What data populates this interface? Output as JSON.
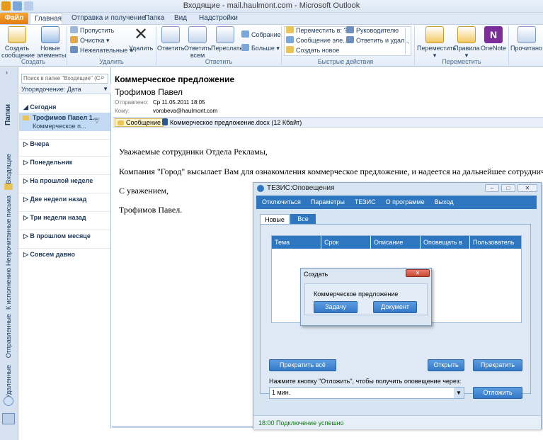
{
  "window": {
    "title": "Входящие - mail.haulmont.com - Microsoft Outlook"
  },
  "ribbon": {
    "tabs": [
      "Файл",
      "Главная",
      "Отправка и получение",
      "Папка",
      "Вид",
      "Надстройки"
    ],
    "create": {
      "new_message": "Создать сообщение",
      "new_items": "Новые элементы",
      "label": "Создать"
    },
    "delete": {
      "ignore": "Пропустить",
      "cleanup": "Очистка",
      "junk": "Нежелательные",
      "delete": "Удалить",
      "label": "Удалить"
    },
    "respond": {
      "reply": "Ответить",
      "reply_all": "Ответить всем",
      "forward": "Переслать",
      "meeting": "Собрание",
      "more": "Больше",
      "label": "Ответить"
    },
    "quick": {
      "move_to": "Переместить в: ?",
      "manager": "Руководителю",
      "team_email": "Сообщение эле...",
      "reply_delete": "Ответить и удал...",
      "create_new": "Создать новое",
      "label": "Быстрые действия"
    },
    "move": {
      "move": "Переместить",
      "rules": "Правила",
      "onenote": "OneNote",
      "label": "Переместить"
    },
    "unread": {
      "read_unread": "Прочитано"
    }
  },
  "nav": {
    "folders": "Папки",
    "inbox": "Входящие",
    "unread": "Непрочитанные письма",
    "todo": "К исполнению",
    "sent": "Отправленные",
    "deleted": "Удаленные"
  },
  "maillist": {
    "search_placeholder": "Поиск в папке \"Входящие\" (C",
    "sort": "Упорядочение: Дата",
    "groups": [
      "Сегодня",
      "Вчера",
      "Понедельник",
      "На прошлой неделе",
      "Две недели назад",
      "Три недели назад",
      "В прошлом месяце",
      "Совсем давно"
    ],
    "selected": {
      "from": "Трофимов Павел 1...",
      "subject": "Коммерческое п..."
    }
  },
  "message": {
    "subject": "Коммерческое предложение",
    "sender": "Трофимов Павел",
    "sent_label": "Отправлено:",
    "sent_value": "Ср 11.05.2011 18:05",
    "to_label": "Кому:",
    "to_value": "vorobeva@haulmont.com",
    "tab_message": "Сообщение",
    "attachment": "Коммерческое предложение.docx (12 Кбайт)",
    "body": [
      "Уважаемые сотрудники Отдела Рекламы,",
      "Компания \"Город\" высылает Вам для ознакомления коммерческое предложение, и надеется на дальнейшее сотрудничество.",
      "С уважением,",
      "Трофимов Павел."
    ]
  },
  "tesis": {
    "title": "ТЕЗИС:Оповещения",
    "menu": [
      "Отключиться",
      "Параметры",
      "ТЕЗИС",
      "О программе",
      "Выход"
    ],
    "tabs": [
      "Новые",
      "Все"
    ],
    "columns": [
      "Тема",
      "Срок",
      "Описание",
      "Оповещать в",
      "Пользователь"
    ],
    "stop_all": "Прекратить всё",
    "open": "Открыть",
    "stop": "Прекратить",
    "postpone_hint": "Нажмите кнопку \"Отложить\", чтобы получить оповещение через:",
    "postpone_value": "1 мин.",
    "postpone": "Отложить",
    "status": "18:00 Подключение успешно"
  },
  "dialog": {
    "title": "Создать",
    "caption": "Коммерческое предложение",
    "task": "Задачу",
    "document": "Документ"
  }
}
